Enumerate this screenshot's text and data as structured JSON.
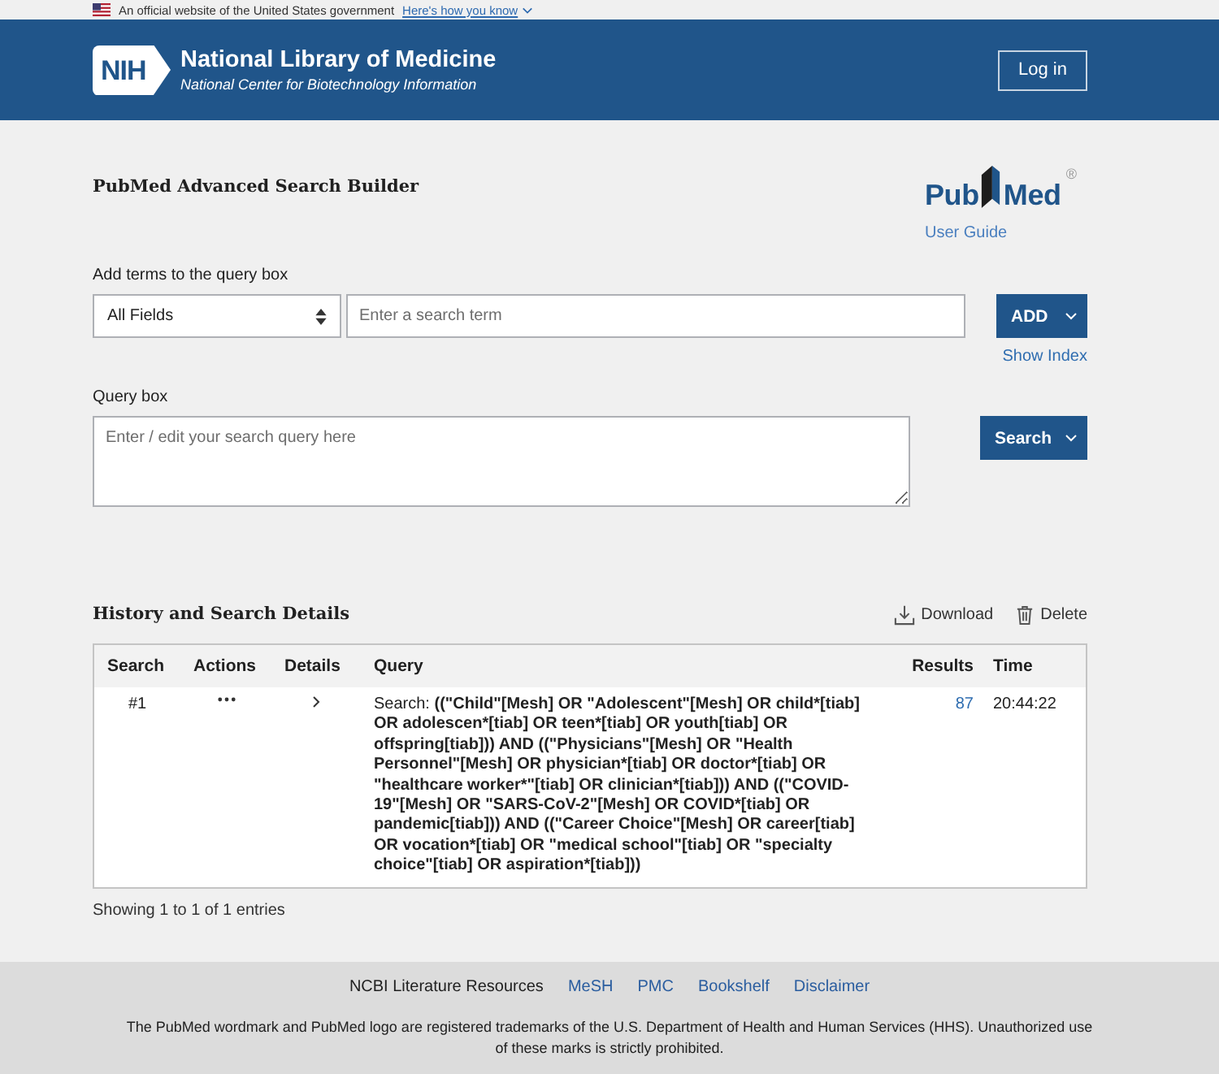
{
  "gov_banner": {
    "text": "An official website of the United States government",
    "link": "Here's how you know"
  },
  "header": {
    "logo": "NIH",
    "title": "National Library of Medicine",
    "subtitle": "National Center for Biotechnology Information",
    "login_button": "Log in"
  },
  "builder": {
    "title": "PubMed Advanced Search Builder",
    "logo": {
      "left": "Pub",
      "right": "Med",
      "mark": "®"
    },
    "user_guide_link": "User Guide",
    "terms_label": "Add terms to the query box",
    "field_select": {
      "value": "All Fields"
    },
    "term_input": {
      "placeholder": "Enter a search term"
    },
    "add_button": "ADD",
    "show_index_link": "Show Index",
    "query_label": "Query box",
    "query_box": {
      "placeholder": "Enter / edit your search query here"
    },
    "search_button": "Search"
  },
  "history": {
    "title": "History and Search Details",
    "tools": [
      {
        "kind": "download",
        "label": "Download"
      },
      {
        "kind": "delete",
        "label": "Delete"
      }
    ],
    "table": {
      "columns": [
        "Search",
        "Actions",
        "Details",
        "Query",
        "Results",
        "Time"
      ],
      "rows": [
        {
          "search": "#1",
          "details_expanded": false,
          "query_label": "Search:",
          "query": "((\"Child\"[Mesh] OR \"Adolescent\"[Mesh] OR child*[tiab] OR adolescen*[tiab] OR teen*[tiab] OR youth[tiab] OR offspring[tiab])) AND ((\"Physicians\"[Mesh] OR \"Health Personnel\"[Mesh] OR physician*[tiab] OR doctor*[tiab] OR \"healthcare worker*\"[tiab] OR clinician*[tiab])) AND ((\"COVID-19\"[Mesh] OR \"SARS-CoV-2\"[Mesh] OR COVID*[tiab] OR pandemic[tiab])) AND ((\"Career Choice\"[Mesh] OR career[tiab] OR vocation*[tiab] OR \"medical school\"[tiab] OR \"specialty choice\"[tiab] OR aspiration*[tiab]))",
          "results": "87",
          "time": "20:44:22"
        }
      ]
    },
    "summary": "Showing 1 to 1 of 1 entries"
  },
  "footer": {
    "resources_label": "NCBI Literature Resources",
    "links": [
      "MeSH",
      "PMC",
      "Bookshelf",
      "Disclaimer"
    ],
    "notice": "The PubMed wordmark and PubMed logo are registered trademarks of the U.S. Department of Health and Human Services (HHS). Unauthorized use of these marks is strictly prohibited."
  }
}
